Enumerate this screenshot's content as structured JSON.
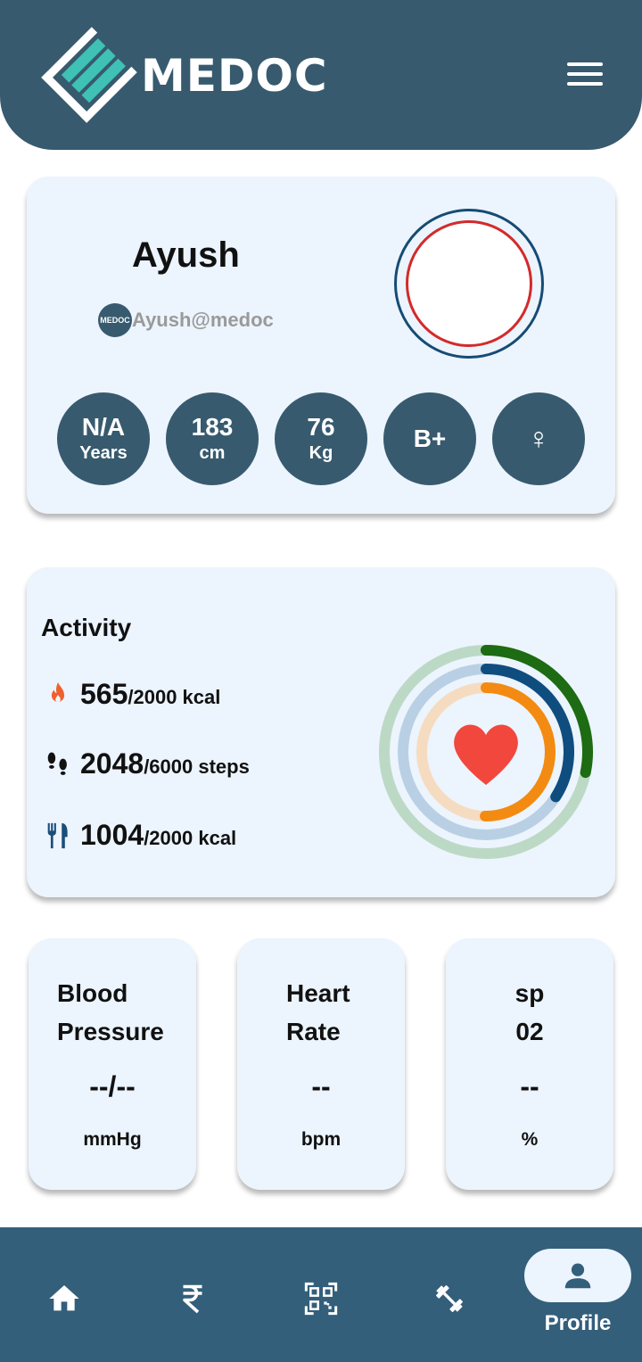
{
  "app": {
    "logo_text": "MEDOC",
    "email_logo_text": "MEDOC"
  },
  "profile": {
    "name": "Ayush",
    "email": "Ayush@medoc",
    "stats": [
      {
        "value": "N/A",
        "unit": "Years"
      },
      {
        "value": "183",
        "unit": "cm"
      },
      {
        "value": "76",
        "unit": "Kg"
      },
      {
        "value": "B+",
        "unit": ""
      },
      {
        "value": "♀",
        "unit": ""
      }
    ]
  },
  "activity": {
    "title": "Activity",
    "rows": [
      {
        "icon": "flame-icon",
        "value": "565",
        "goal": "/2000 kcal",
        "progress": 0.2825
      },
      {
        "icon": "footsteps-icon",
        "value": "2048",
        "goal": "/6000 steps",
        "progress": 0.341
      },
      {
        "icon": "cutlery-icon",
        "value": "1004",
        "goal": "/2000 kcal",
        "progress": 0.502
      }
    ],
    "ring_colors": {
      "outer": "#1d6b12",
      "outer_track": "#bcd9c5",
      "middle": "#0f4d7f",
      "middle_track": "#b9d0e4",
      "inner": "#f38b12",
      "inner_track": "#f5dcc0",
      "heart": "#f2473d"
    }
  },
  "vitals": [
    {
      "title_line1": "Blood",
      "title_line2": "Pressure",
      "value": "--/--",
      "unit": "mmHg"
    },
    {
      "title_line1": "Heart",
      "title_line2": "Rate",
      "value": "--",
      "unit": "bpm"
    },
    {
      "title_line1": "sp",
      "title_line2": "02",
      "value": "--",
      "unit": "%"
    }
  ],
  "nav": {
    "items": [
      "home-icon",
      "rupee-icon",
      "qr-code-icon",
      "dumbbell-icon",
      "profile-icon"
    ],
    "active_label": "Profile"
  },
  "colors": {
    "header": "#375a6e",
    "card": "#ecf4fd",
    "accent_teal": "#3fc1b5",
    "nav": "#335f7b"
  }
}
